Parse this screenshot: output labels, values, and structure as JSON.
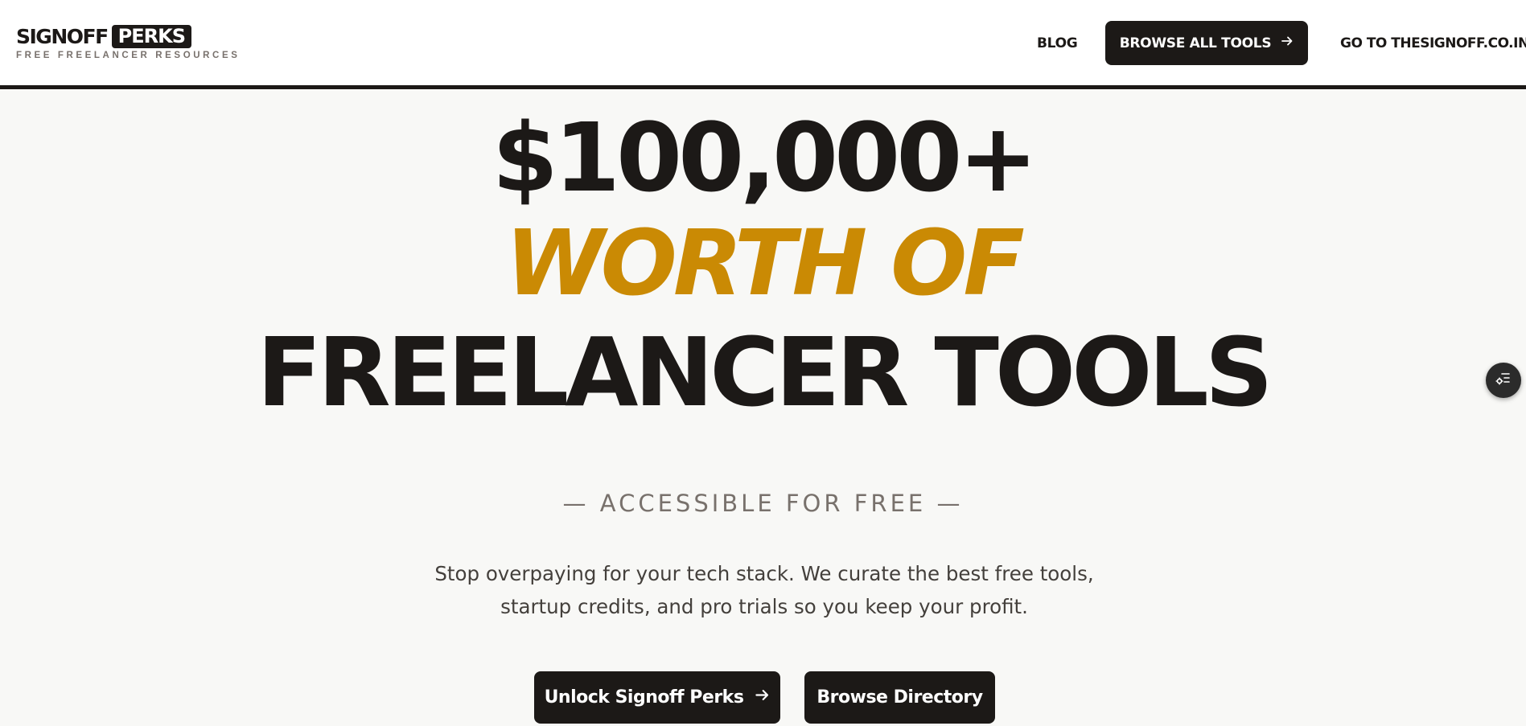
{
  "header": {
    "logo": {
      "word1": "SIGNOFF",
      "word2": "PERKS",
      "tagline": "FREE FREELANCER RESOURCES"
    },
    "nav": {
      "blog_label": "BLOG",
      "browse_label": "BROWSE ALL TOOLS",
      "browse_icon": "arrow-right-icon",
      "goto_label": "GO TO THESIGNOFF.CO.IN"
    }
  },
  "hero": {
    "line1": "$100,000+",
    "line2": "WORTH OF",
    "line3": "FREELANCER TOOLS",
    "tagline": "— ACCESSIBLE FOR FREE —",
    "description": "Stop overpaying for your tech stack. We curate the best free tools, startup credits, and pro trials so you keep your profit.",
    "primary_button": "Unlock Signoff Perks",
    "primary_icon": "arrow-right-icon",
    "secondary_button": "Browse Directory"
  },
  "floating": {
    "icon": "list-settings-icon"
  },
  "colors": {
    "ink": "#1c1917",
    "accent": "#ca8a04",
    "muted": "#78716c",
    "background": "#f8f8f6"
  }
}
